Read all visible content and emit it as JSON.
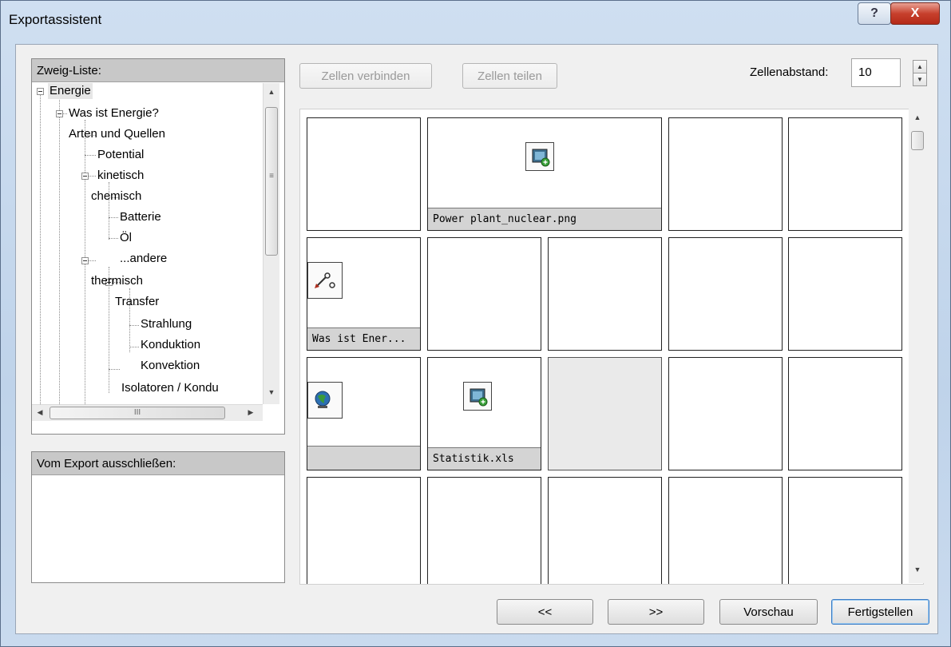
{
  "window": {
    "title": "Exportassistent",
    "help_glyph": "?",
    "close_glyph": "X"
  },
  "branch_list": {
    "header": "Zweig-Liste:",
    "items": [
      {
        "label": "Energie"
      },
      {
        "label": "Was ist Energie?"
      },
      {
        "label": "Arten und Quellen"
      },
      {
        "label": "Potential"
      },
      {
        "label": "kinetisch"
      },
      {
        "label": "chemisch"
      },
      {
        "label": "Batterie"
      },
      {
        "label": "Öl"
      },
      {
        "label": "...andere"
      },
      {
        "label": "thermisch"
      },
      {
        "label": "Transfer"
      },
      {
        "label": "Strahlung"
      },
      {
        "label": "Konduktion"
      },
      {
        "label": "Konvektion"
      },
      {
        "label": "Isolatoren / Kondu"
      }
    ],
    "hscroll_grip": "III",
    "vscroll_grip": "≡"
  },
  "exclude_panel": {
    "header": "Vom Export ausschließen:"
  },
  "toolbar": {
    "merge_cells": "Zellen verbinden",
    "split_cells": "Zellen teilen",
    "spacing_label": "Zellenabstand:",
    "spacing_value": "10"
  },
  "grid": {
    "cells": {
      "power_plant": "Power plant_nuclear.png",
      "was_ist": "Was ist Ener...",
      "statistik": "Statistik.xls"
    }
  },
  "footer": {
    "back": "<<",
    "next": ">>",
    "preview": "Vorschau",
    "finish": "Fertigstellen"
  }
}
